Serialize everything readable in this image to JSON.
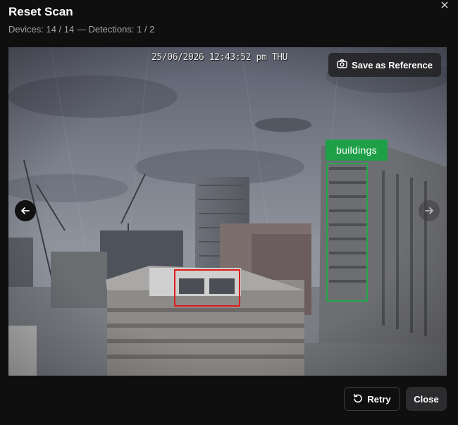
{
  "dialog": {
    "title": "Reset Scan",
    "subtitle": "Devices: 14 / 14 — Detections: 1 / 2"
  },
  "viewer": {
    "timestamp": "25/06/2026 12:43:52 pm THU",
    "save_reference_label": "Save as Reference",
    "detections": [
      {
        "label": "buildings",
        "color": "#1fa048"
      },
      {
        "label": "",
        "color": "#e01b1b"
      }
    ]
  },
  "footer": {
    "retry_label": "Retry",
    "close_label": "Close"
  },
  "icons": [
    "close-icon",
    "camera-icon",
    "arrow-left-icon",
    "arrow-right-icon",
    "retry-icon"
  ]
}
